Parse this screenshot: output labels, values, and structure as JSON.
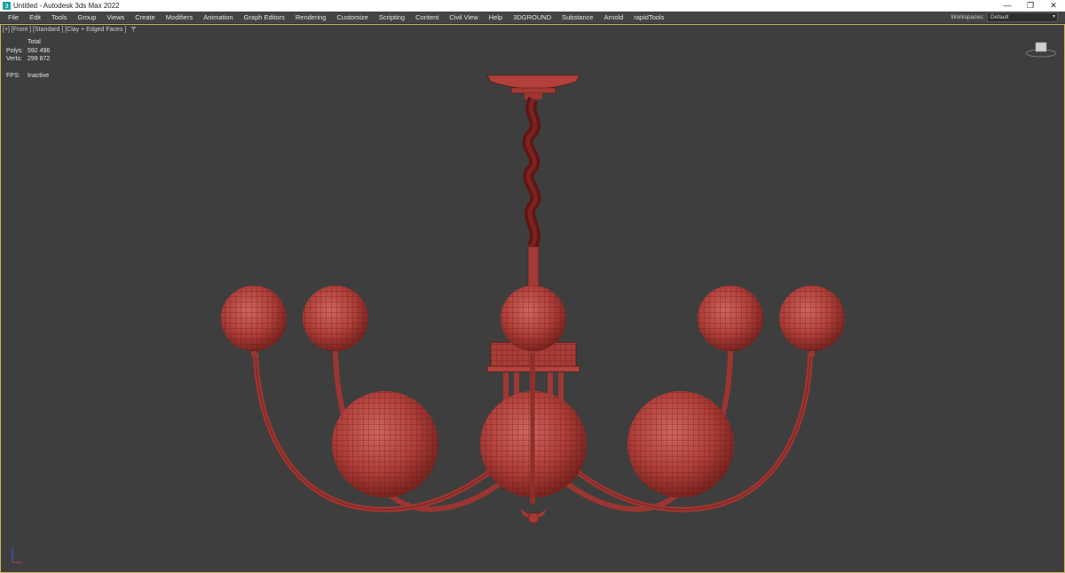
{
  "window": {
    "title": "Untitled - Autodesk 3ds Max 2022",
    "controls": {
      "minimize": "—",
      "restore": "❐",
      "close": "✕"
    }
  },
  "menu": {
    "items": [
      {
        "label": "File",
        "mn": "F",
        "rest": "ile"
      },
      {
        "label": "Edit",
        "mn": "E",
        "rest": "dit"
      },
      {
        "label": "Tools",
        "mn": "T",
        "rest": "ools"
      },
      {
        "label": "Group",
        "mn": "G",
        "rest": "roup"
      },
      {
        "label": "Views",
        "mn": "V",
        "rest": "iews"
      },
      {
        "label": "Create",
        "mn": "C",
        "rest": "reate"
      },
      {
        "label": "Modifiers",
        "mn": "M",
        "rest": "odifiers"
      },
      {
        "label": "Animation",
        "mn": "A",
        "rest": "nimation"
      },
      {
        "label": "Graph Editors",
        "pre": "Graph E",
        "mn": "d",
        "rest": "itors"
      },
      {
        "label": "Rendering",
        "mn": "R",
        "rest": "endering"
      },
      {
        "label": "Customize",
        "pre": "C",
        "mn": "u",
        "rest": "stomize"
      },
      {
        "label": "Scripting",
        "mn": "S",
        "rest": "cripting"
      },
      {
        "label": "Content",
        "pre": "",
        "mn": "",
        "rest": "Content"
      },
      {
        "label": "Civil View",
        "pre": "Civil ",
        "mn": "V",
        "rest": "iew"
      },
      {
        "label": "Help",
        "mn": "H",
        "rest": "elp"
      },
      {
        "label": "3DGROUND",
        "pre": "",
        "mn": "",
        "rest": "3DGROUND"
      },
      {
        "label": "Substance",
        "pre": "",
        "mn": "",
        "rest": "Substance"
      },
      {
        "label": "Arnold",
        "pre": "",
        "mn": "",
        "rest": "Arnold"
      },
      {
        "label": "rapidTools",
        "pre": "",
        "mn": "",
        "rest": "rapidTools"
      }
    ],
    "workspaces_label": "Workspaces:",
    "workspaces_value": "Default"
  },
  "viewport": {
    "label": "[+] [Front ] [Standard ] [Clay + Edged Faces ]",
    "filter_icon": "funnel-icon",
    "stats": {
      "header": "Total",
      "polys_label": "Polys:",
      "polys_value": "592 496",
      "verts_label": "Verts:",
      "verts_value": "299 872",
      "fps_label": "FPS:",
      "fps_value": "Inactive"
    }
  },
  "colors": {
    "clay": "#b5403a",
    "clay_dark": "#6e1a18",
    "wire": "#4a0f0e",
    "viewport_bg": "#3e3e3e",
    "viewport_border": "#c9b45c"
  }
}
